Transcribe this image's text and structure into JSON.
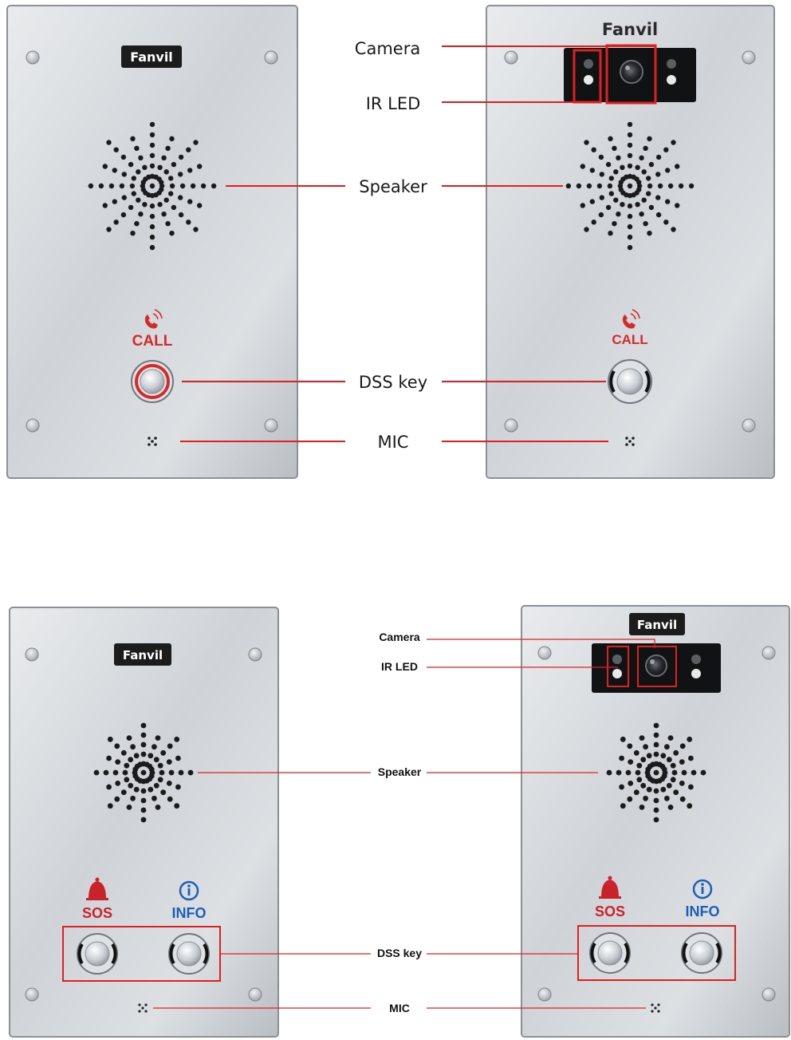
{
  "brand": "Fanvil",
  "panel_text": {
    "call": "CALL",
    "sos": "SOS",
    "info": "INFO"
  },
  "callouts_top": {
    "camera": "Camera",
    "ir_led": "IR LED",
    "speaker": "Speaker",
    "dss_key": "DSS key",
    "mic": "MIC"
  },
  "callouts_bottom": {
    "camera": "Camera",
    "ir_led": "IR LED",
    "speaker": "Speaker",
    "dss_key": "DSS key",
    "mic": "MIC"
  },
  "colors": {
    "callout_line": "#e02020",
    "call_text": "#d42a2a",
    "sos_text": "#c8232b",
    "info_text": "#1d5fb8"
  },
  "icons": [
    "phone-ringing-icon",
    "bell-icon",
    "info-circle-icon"
  ]
}
